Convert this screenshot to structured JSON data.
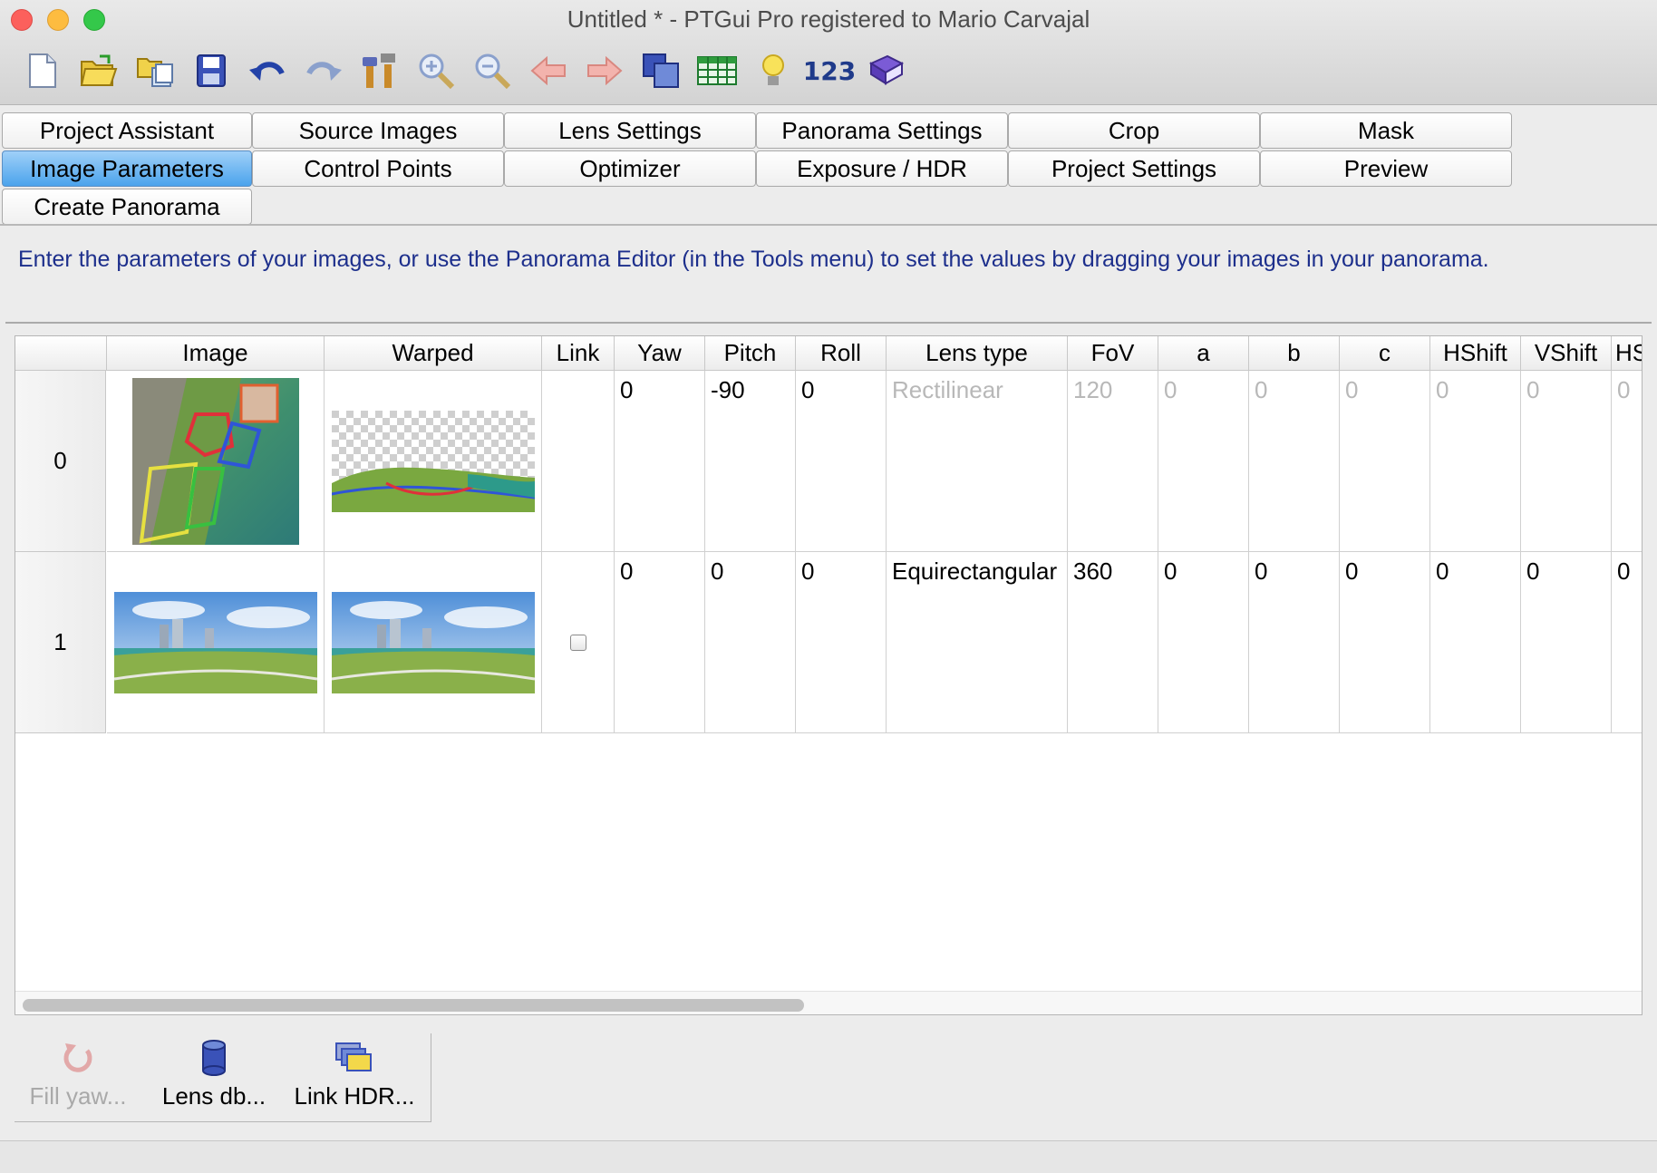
{
  "window": {
    "title": "Untitled * - PTGui Pro registered to Mario Carvajal"
  },
  "toolbar": {
    "items": [
      {
        "icon": "new-document-icon"
      },
      {
        "icon": "open-folder-icon"
      },
      {
        "icon": "open-images-icon"
      },
      {
        "icon": "save-icon"
      },
      {
        "icon": "undo-icon"
      },
      {
        "icon": "redo-icon"
      },
      {
        "icon": "tools-icon"
      },
      {
        "icon": "zoom-in-icon"
      },
      {
        "icon": "zoom-out-icon"
      },
      {
        "icon": "arrow-left-icon"
      },
      {
        "icon": "arrow-right-icon"
      },
      {
        "icon": "panorama-editor-icon"
      },
      {
        "icon": "table-icon"
      },
      {
        "icon": "lightbulb-icon"
      },
      {
        "icon": "numbers-icon",
        "label": "123"
      },
      {
        "icon": "help-book-icon"
      }
    ]
  },
  "tabs": {
    "row1": [
      "Project Assistant",
      "Source Images",
      "Lens Settings",
      "Panorama Settings",
      "Crop",
      "Mask"
    ],
    "row2": [
      "Image Parameters",
      "Control Points",
      "Optimizer",
      "Exposure / HDR",
      "Project Settings",
      "Preview"
    ],
    "row3": [
      "Create Panorama"
    ],
    "active": "Image Parameters"
  },
  "instructions": "Enter the parameters of your images, or use the Panorama Editor (in the Tools menu) to set the values by dragging your images in your panorama.",
  "table": {
    "columns": [
      "Image",
      "Warped",
      "Link",
      "Yaw",
      "Pitch",
      "Roll",
      "Lens type",
      "FoV",
      "a",
      "b",
      "c",
      "HShift",
      "VShift",
      "HS"
    ],
    "rows": [
      {
        "index": "0",
        "yaw": "0",
        "pitch": "-90",
        "roll": "0",
        "lens_type": "Rectilinear",
        "fov": "120",
        "a": "0",
        "b": "0",
        "c": "0",
        "hshift": "0",
        "vshift": "0",
        "hs": "0",
        "dim": true,
        "link_checkbox": false
      },
      {
        "index": "1",
        "yaw": "0",
        "pitch": "0",
        "roll": "0",
        "lens_type": "Equirectangular",
        "fov": "360",
        "a": "0",
        "b": "0",
        "c": "0",
        "hshift": "0",
        "vshift": "0",
        "hs": "0",
        "dim": false,
        "link_checkbox": true
      }
    ]
  },
  "bottom_buttons": {
    "fill_yaw": "Fill yaw...",
    "lens_db": "Lens db...",
    "link_hdr": "Link HDR..."
  },
  "colors": {
    "active_tab": "#4ba3ec",
    "instruction_text": "#1d2f8c",
    "dim_text": "#b8b8b8"
  }
}
